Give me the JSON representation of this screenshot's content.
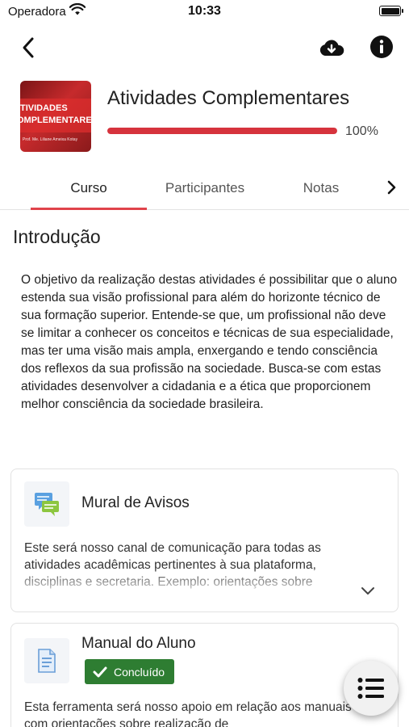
{
  "status_bar": {
    "carrier": "Operadora",
    "time": "10:33"
  },
  "nav": {
    "back_icon": "chevron-left-icon",
    "download_icon": "cloud-download-icon",
    "info_icon": "info-icon"
  },
  "course": {
    "title": "Atividades Complementares",
    "progress_percent": 100,
    "progress_label": "100%",
    "thumbnail": {
      "line1": "TIVIDADES",
      "line2": "OMPLEMENTARE",
      "line3": "Prof. Me. Liliane Ameixa Kotay"
    }
  },
  "tabs": [
    {
      "label": "Curso",
      "active": true
    },
    {
      "label": "Participantes",
      "active": false
    },
    {
      "label": "Notas",
      "active": false
    }
  ],
  "section": {
    "title": "Introdução",
    "paragraph": "O objetivo da realização destas atividades é possibilitar que o aluno estenda sua visão profissional para além do horizonte técnico de sua formação superior. Entende-se que, um profissional não deve se limitar a conhecer os conceitos e técnicas de sua especialidade, mas ter uma visão mais ampla, enxergando e tendo consciência dos reflexos da sua profissão na sociedade. Busca-se com estas atividades desenvolver a cidadania e a ética que proporcionem melhor consciência da sociedade brasileira."
  },
  "cards": [
    {
      "title": "Mural de Avisos",
      "icon": "forum-chat-icon",
      "description": "Este será nosso canal de comunicação para todas as atividades acadêmicas pertinentes à sua plataforma, disciplinas e secretaria. Exemplo: orientações sobre"
    },
    {
      "title": "Manual do Aluno",
      "icon": "document-page-icon",
      "badge": "Concluído",
      "description": "Esta ferramenta será nosso apoio em relação aos manuais com orientações sobre realização de"
    }
  ],
  "colors": {
    "accent": "#e0434b",
    "progress": "#d6333d",
    "completed": "#2e7d32"
  },
  "fab_icon": "list-menu-icon"
}
